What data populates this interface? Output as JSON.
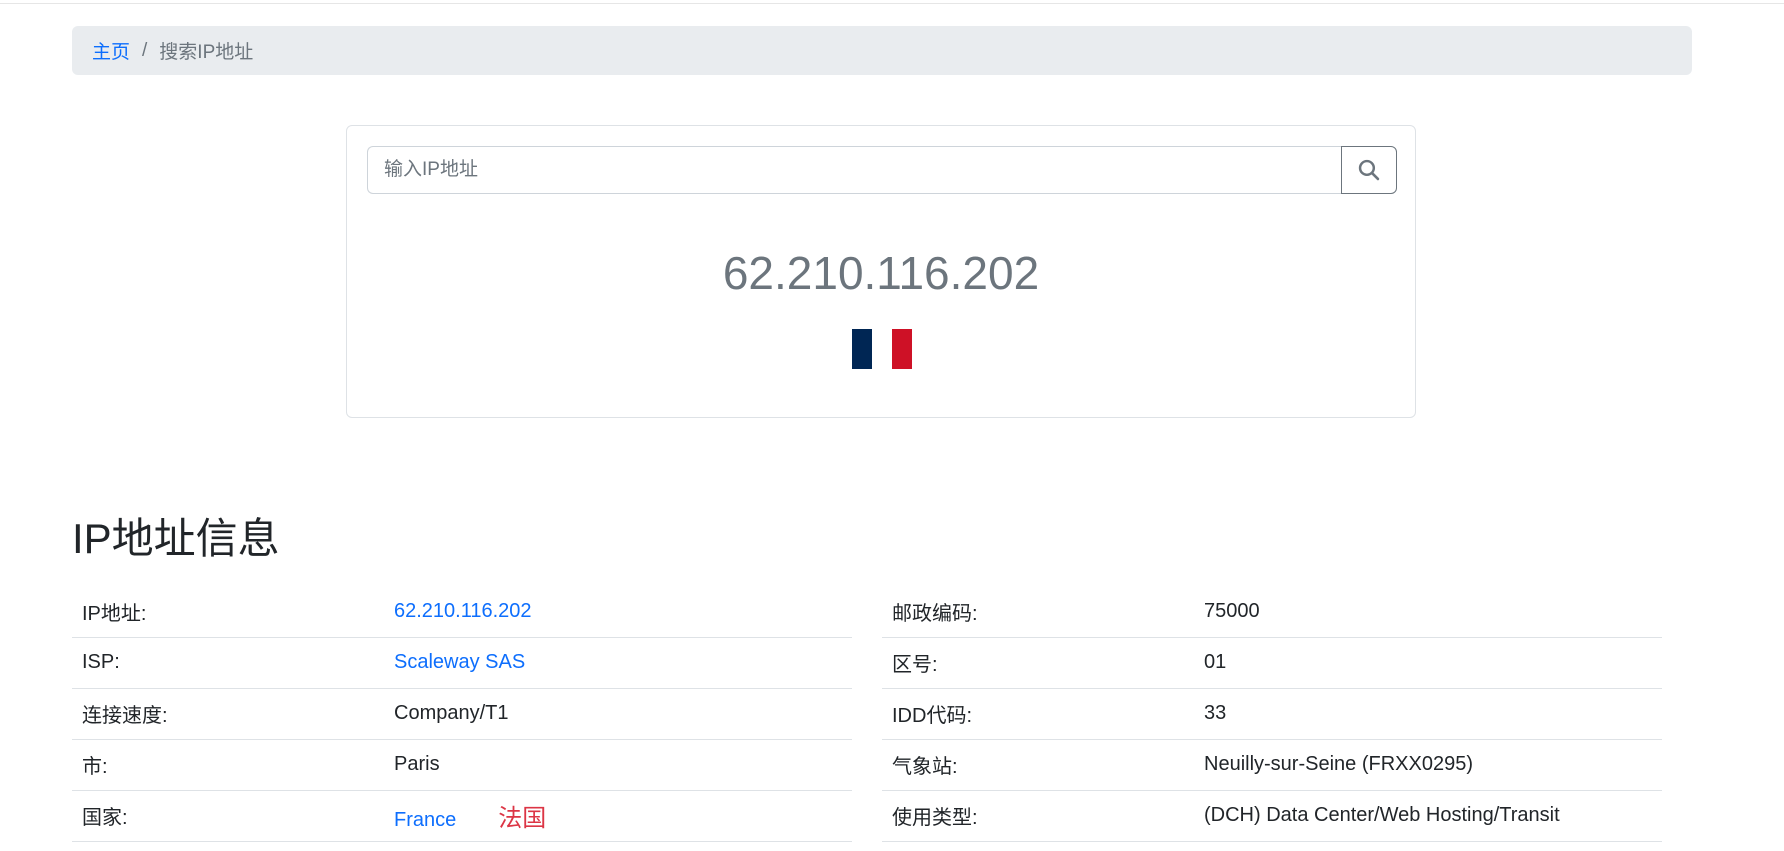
{
  "breadcrumb": {
    "home": "主页",
    "separator": "/",
    "current": "搜索IP地址"
  },
  "search": {
    "placeholder": "输入IP地址",
    "value": "",
    "button_icon": "search-icon"
  },
  "result": {
    "ip": "62.210.116.202",
    "flag": {
      "country": "France",
      "colors": [
        "#002654",
        "#ffffff",
        "#ce1126"
      ]
    }
  },
  "section": {
    "title": "IP地址信息"
  },
  "left_rows": [
    {
      "label": "IP地址:",
      "value": "62.210.116.202",
      "link": true
    },
    {
      "label": "ISP:",
      "value": "Scaleway SAS",
      "link": true
    },
    {
      "label": "连接速度:",
      "value": "Company/T1",
      "link": false
    },
    {
      "label": "市:",
      "value": "Paris",
      "link": false
    },
    {
      "label": "国家:",
      "value": "France",
      "link": true,
      "extra": "法国"
    }
  ],
  "right_rows": [
    {
      "label": "邮政编码:",
      "value": "75000"
    },
    {
      "label": "区号:",
      "value": "01"
    },
    {
      "label": "IDD代码:",
      "value": "33"
    },
    {
      "label": "气象站:",
      "value": "Neuilly-sur-Seine (FRXX0295)"
    },
    {
      "label": "使用类型:",
      "value": "(DCH) Data Center/Web Hosting/Transit"
    }
  ],
  "colors": {
    "link": "#0d6efd",
    "accent_red": "#dc3545",
    "muted": "#6c757d"
  }
}
